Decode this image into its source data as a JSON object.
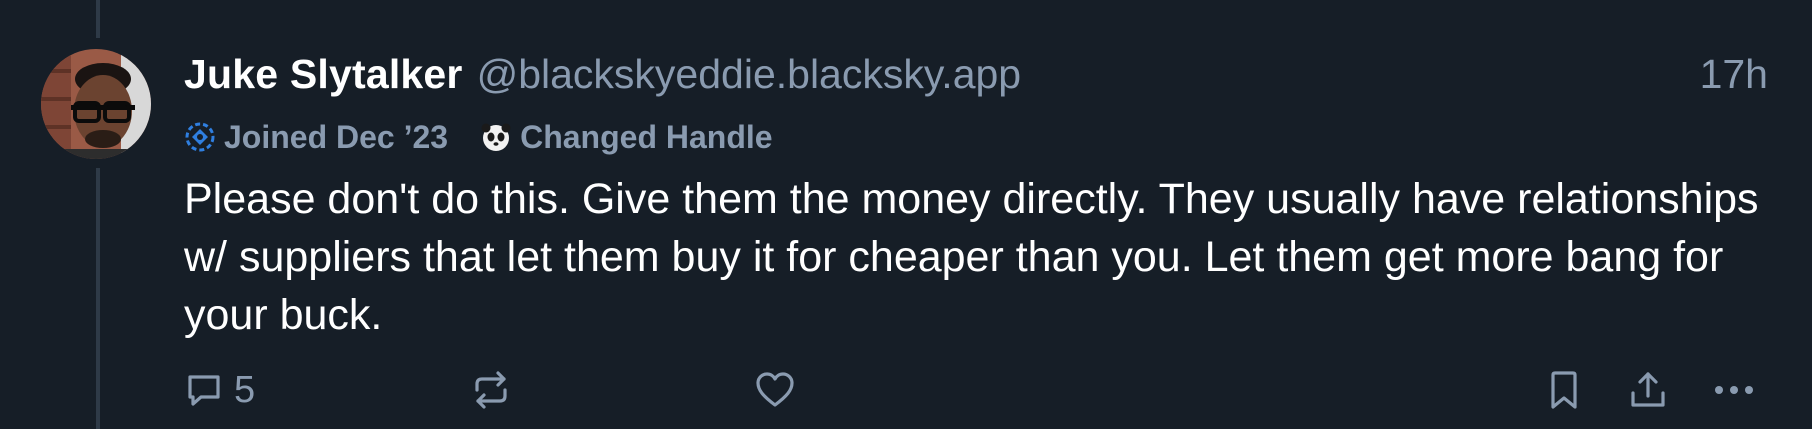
{
  "author": {
    "display_name": "Juke Slytalker",
    "handle": "@blackskyeddie.blacksky.app",
    "avatar_icon": "avatar-photo"
  },
  "timestamp": "17h",
  "badges": [
    {
      "label": "Joined Dec ’23",
      "icon": "blacksky-icon"
    },
    {
      "label": "Changed Handle",
      "icon": "panda-icon"
    }
  ],
  "post": {
    "text": "Please don't do this. Give them the money directly. They usually have relationships w/ suppliers that let them buy it for cheaper than you. Let them get more bang for your buck."
  },
  "actions": {
    "reply_count": "5",
    "icons": [
      "reply-icon",
      "repost-icon",
      "like-icon",
      "bookmark-icon",
      "share-icon",
      "more-icon"
    ]
  },
  "colors": {
    "background": "#161e27",
    "muted_text": "#8a9bb0",
    "thread_line": "#2e3a47",
    "accent_blue": "#2f7fe0"
  }
}
